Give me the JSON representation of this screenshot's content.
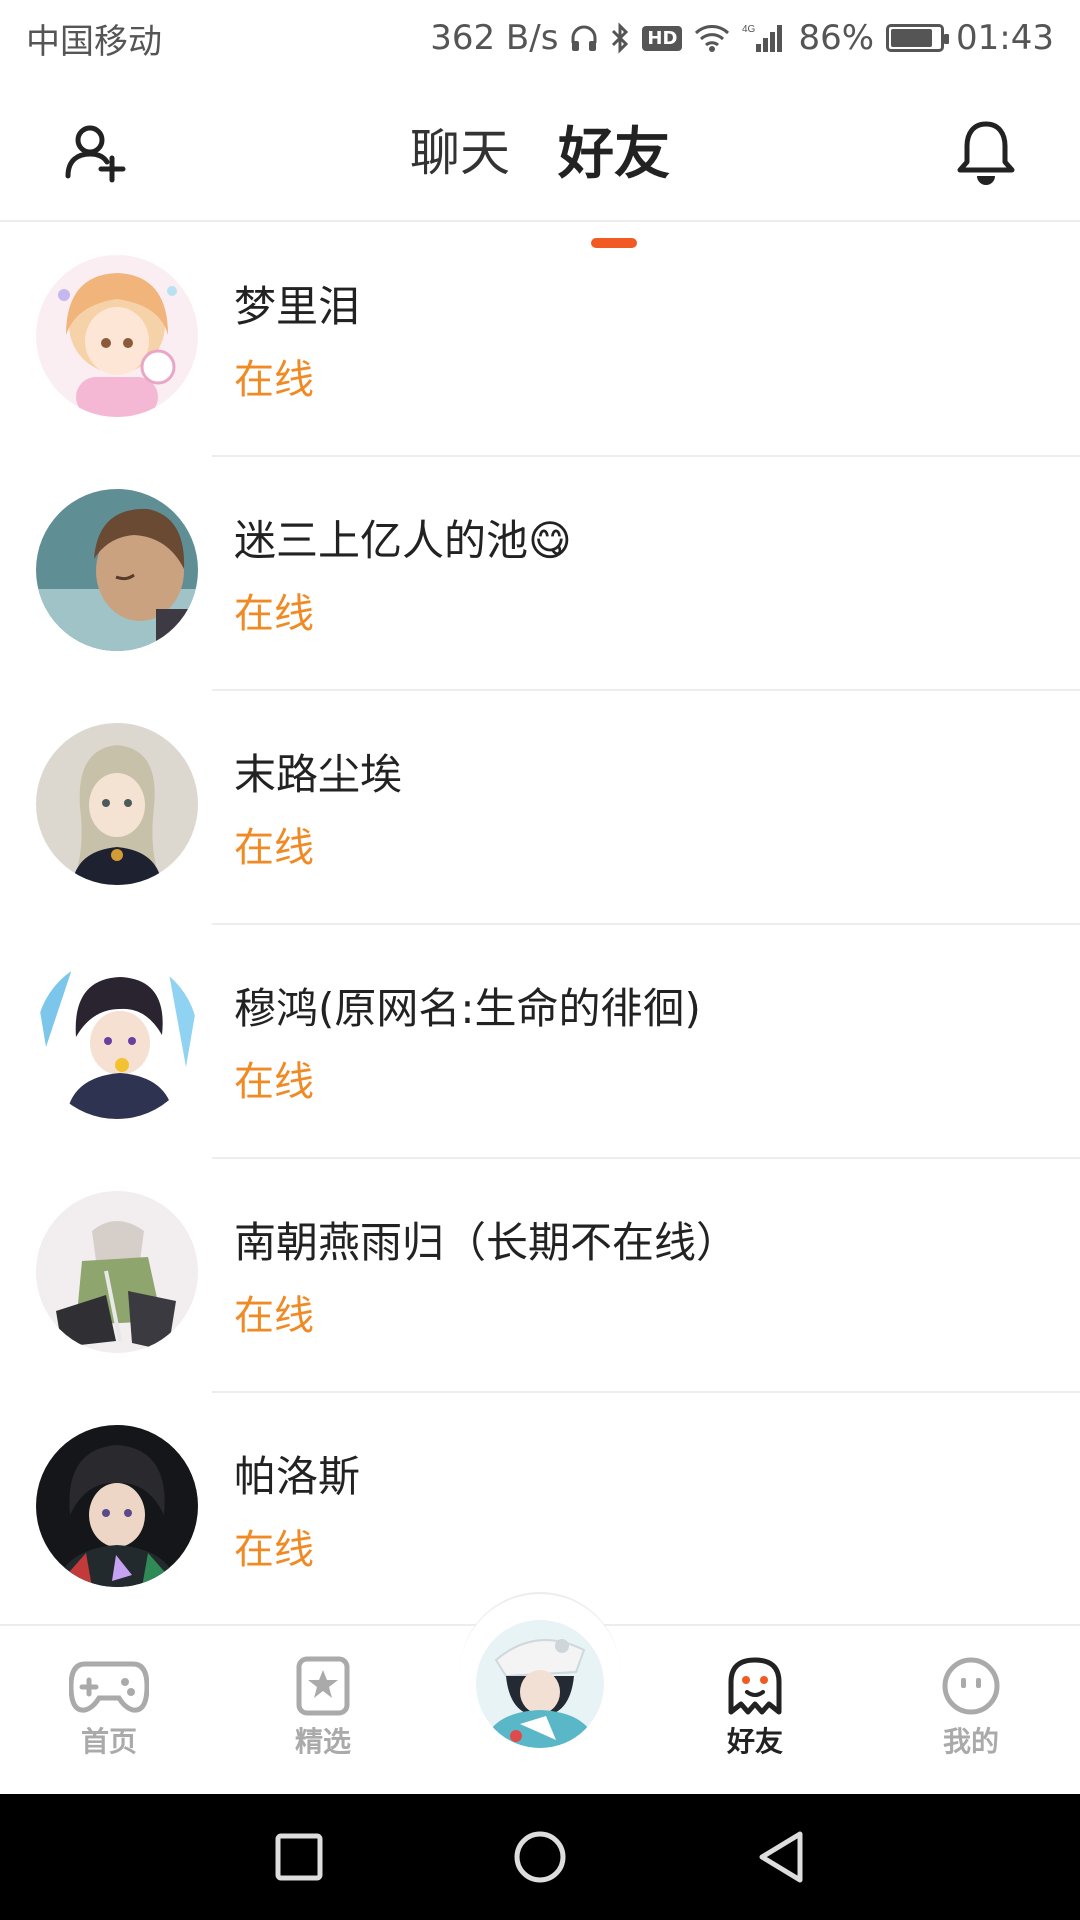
{
  "status_bar": {
    "carrier": "中国移动",
    "net_speed": "362 B/s",
    "hd_label": "HD",
    "network_type": "4G",
    "battery_percent": "86%",
    "battery_level": 0.86,
    "time": "01:43"
  },
  "header": {
    "tabs": [
      {
        "label": "聊天",
        "active": false
      },
      {
        "label": "好友",
        "active": true
      }
    ],
    "accent_color": "#f15a22"
  },
  "friends": [
    {
      "name": "梦里泪",
      "status": "在线"
    },
    {
      "name": "迷三上亿人的池😋",
      "status": "在线"
    },
    {
      "name": "末路尘埃",
      "status": "在线"
    },
    {
      "name": "穆鸿(原网名:生命的徘徊)",
      "status": "在线"
    },
    {
      "name": "南朝燕雨归（长期不在线）",
      "status": "在线"
    },
    {
      "name": "帕洛斯",
      "status": "在线"
    }
  ],
  "status_color": "#f08a24",
  "bottom_nav": {
    "items": [
      {
        "label": "首页",
        "icon": "gamepad-icon",
        "active": false
      },
      {
        "label": "精选",
        "icon": "star-bookmark-icon",
        "active": false
      },
      {
        "label": "好友",
        "icon": "ghost-icon",
        "active": true
      },
      {
        "label": "我的",
        "icon": "smiley-face-icon",
        "active": false
      }
    ]
  }
}
